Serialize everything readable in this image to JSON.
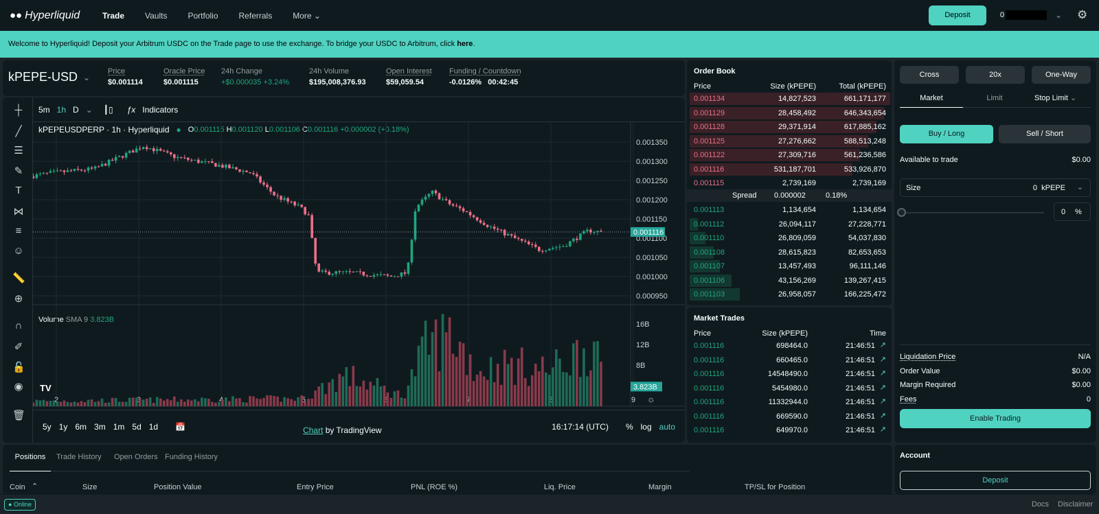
{
  "nav": {
    "brand": "Hyperliquid",
    "items": [
      "Trade",
      "Vaults",
      "Portfolio",
      "Referrals",
      "More"
    ],
    "deposit": "Deposit",
    "account": "0"
  },
  "banner": {
    "text": "Welcome to Hyperliquid! Deposit your Arbitrum USDC on the Trade page to use the exchange. To bridge your USDC to Arbitrum, click ",
    "link": "here",
    "end": "."
  },
  "market": {
    "symbol": "kPEPE-USD",
    "stats": [
      {
        "label": "Price",
        "value": "$0.001114"
      },
      {
        "label": "Oracle Price",
        "value": "$0.001115"
      },
      {
        "label": "24h Change",
        "value": "+$0.000035 +3.24%"
      },
      {
        "label": "24h Volume",
        "value": "$195,008,376.93"
      },
      {
        "label": "Open Interest",
        "value": "$59,059.54"
      },
      {
        "label": "Funding / Countdown",
        "value": "-0.0126%",
        "value2": "00:42:45"
      }
    ]
  },
  "chart": {
    "intervals": [
      "5m",
      "1h",
      "D"
    ],
    "indicators": "Indicators",
    "title": "kPEPEUSDPERP · 1h · Hyperliquid",
    "ohlc": {
      "o": "0.001115",
      "h": "0.001120",
      "l": "0.001106",
      "c": "0.001116",
      "chg": "+0.000002 (+0.18%)"
    },
    "volume_label": "Volume",
    "sma": "SMA 9",
    "volume_value": "3.823B",
    "last_price": "0.001116",
    "last_volume": "3.823B",
    "ranges": [
      "5y",
      "1y",
      "6m",
      "3m",
      "1m",
      "5d",
      "1d"
    ],
    "credit_link": "Chart",
    "credit": " by TradingView",
    "clock": "16:17:14 (UTC)",
    "scale": [
      "%",
      "log",
      "auto"
    ]
  },
  "chart_data": {
    "type": "candlestick",
    "x_ticks": [
      "2",
      "3",
      "4",
      "5",
      "6",
      "7",
      "8",
      "9"
    ],
    "y_ticks": [
      "0.001350",
      "0.001300",
      "0.001250",
      "0.001200",
      "0.001150",
      "0.001100",
      "0.001050",
      "0.001000",
      "0.000950"
    ],
    "ylim": [
      0.00093,
      0.00137
    ],
    "volume_ticks": [
      "16B",
      "12B",
      "8B"
    ],
    "price_path": [
      [
        1.7,
        0.00126
      ],
      [
        2.0,
        0.00127
      ],
      [
        2.5,
        0.00128
      ],
      [
        2.9,
        0.00132
      ],
      [
        3.1,
        0.00134
      ],
      [
        3.5,
        0.00131
      ],
      [
        4.0,
        0.00129
      ],
      [
        4.4,
        0.00127
      ],
      [
        4.7,
        0.00121
      ],
      [
        5.0,
        0.00118
      ],
      [
        5.1,
        0.00116
      ],
      [
        5.2,
        0.00101
      ],
      [
        5.6,
        0.00101
      ],
      [
        6.1,
        0.001
      ],
      [
        6.3,
        0.00101
      ],
      [
        6.4,
        0.00118
      ],
      [
        6.6,
        0.00122
      ],
      [
        6.8,
        0.00119
      ],
      [
        7.0,
        0.00117
      ],
      [
        7.3,
        0.00113
      ],
      [
        7.6,
        0.0011
      ],
      [
        7.9,
        0.00107
      ],
      [
        8.2,
        0.00108
      ],
      [
        8.5,
        0.00112
      ],
      [
        8.65,
        0.001116
      ]
    ],
    "volume_path": [
      [
        1.7,
        1
      ],
      [
        5.0,
        1.5
      ],
      [
        5.5,
        6
      ],
      [
        6.2,
        2
      ],
      [
        6.5,
        12
      ],
      [
        6.8,
        14
      ],
      [
        7.1,
        7
      ],
      [
        7.5,
        8
      ],
      [
        8.0,
        7
      ],
      [
        8.5,
        12
      ],
      [
        8.65,
        4
      ]
    ]
  },
  "orderbook": {
    "title": "Order Book",
    "headers": [
      "Price",
      "Size (kPEPE)",
      "Total (kPEPE)"
    ],
    "asks": [
      [
        "0.001134",
        "14,827,523",
        "661,171,177",
        1
      ],
      [
        "0.001129",
        "28,458,492",
        "646,343,654",
        0.97
      ],
      [
        "0.001128",
        "29,371,914",
        "617,885,162",
        0.93
      ],
      [
        "0.001125",
        "27,276,662",
        "588,513,248",
        0.89
      ],
      [
        "0.001122",
        "27,309,716",
        "561,236,586",
        0.85
      ],
      [
        "0.001116",
        "531,187,701",
        "533,926,870",
        0.81
      ],
      [
        "0.001115",
        "2,739,169",
        "2,739,169",
        0.0
      ]
    ],
    "spread": {
      "label": "Spread",
      "value": "0.000002",
      "pct": "0.18%"
    },
    "bids": [
      [
        "0.001113",
        "1,134,654",
        "1,134,654",
        0.0
      ],
      [
        "0.001112",
        "26,094,117",
        "27,228,771",
        0.04
      ],
      [
        "0.001110",
        "26,809,059",
        "54,037,830",
        0.08
      ],
      [
        "0.001108",
        "28,615,823",
        "82,653,653",
        0.12
      ],
      [
        "0.001107",
        "13,457,493",
        "96,111,146",
        0.15
      ],
      [
        "0.001106",
        "43,156,269",
        "139,267,415",
        0.21
      ],
      [
        "0.001103",
        "26,958,057",
        "166,225,472",
        0.25
      ]
    ]
  },
  "trades": {
    "title": "Market Trades",
    "headers": [
      "Price",
      "Size (kPEPE)",
      "Time"
    ],
    "rows": [
      [
        "0.001116",
        "698464.0",
        "21:46:51"
      ],
      [
        "0.001116",
        "660465.0",
        "21:46:51"
      ],
      [
        "0.001116",
        "14548490.0",
        "21:46:51"
      ],
      [
        "0.001116",
        "5454980.0",
        "21:46:51"
      ],
      [
        "0.001116",
        "11332944.0",
        "21:46:51"
      ],
      [
        "0.001116",
        "669590.0",
        "21:46:51"
      ],
      [
        "0.001116",
        "649970.0",
        "21:46:51"
      ]
    ]
  },
  "order": {
    "margin": "Cross",
    "leverage": "20x",
    "mode": "One-Way",
    "tabs": [
      "Market",
      "Limit",
      "Stop Limit"
    ],
    "buy": "Buy / Long",
    "sell": "Sell / Short",
    "available_label": "Available to trade",
    "available": "$0.00",
    "size_label": "Size",
    "size_value": "0",
    "size_unit": "kPEPE",
    "pct": "0",
    "pct_sign": "%",
    "slider": 0,
    "summary": [
      [
        "Liquidation Price",
        "N/A"
      ],
      [
        "Order Value",
        "$0.00"
      ],
      [
        "Margin Required",
        "$0.00"
      ],
      [
        "Fees",
        "0"
      ]
    ],
    "enable": "Enable Trading"
  },
  "account": {
    "title": "Account",
    "deposit": "Deposit"
  },
  "positions": {
    "tabs": [
      "Positions",
      "Trade History",
      "Open Orders",
      "Funding History"
    ],
    "columns": [
      "Coin",
      "Size",
      "Position Value",
      "Entry Price",
      "PNL (ROE %)",
      "Liq. Price",
      "Margin",
      "TP/SL for Position"
    ]
  },
  "footer": {
    "status": "Online",
    "links": [
      "Docs",
      "Disclaimer"
    ]
  },
  "colors": {
    "accent": "#50d2c1",
    "up": "#1fa67d",
    "down": "#ed7088"
  }
}
